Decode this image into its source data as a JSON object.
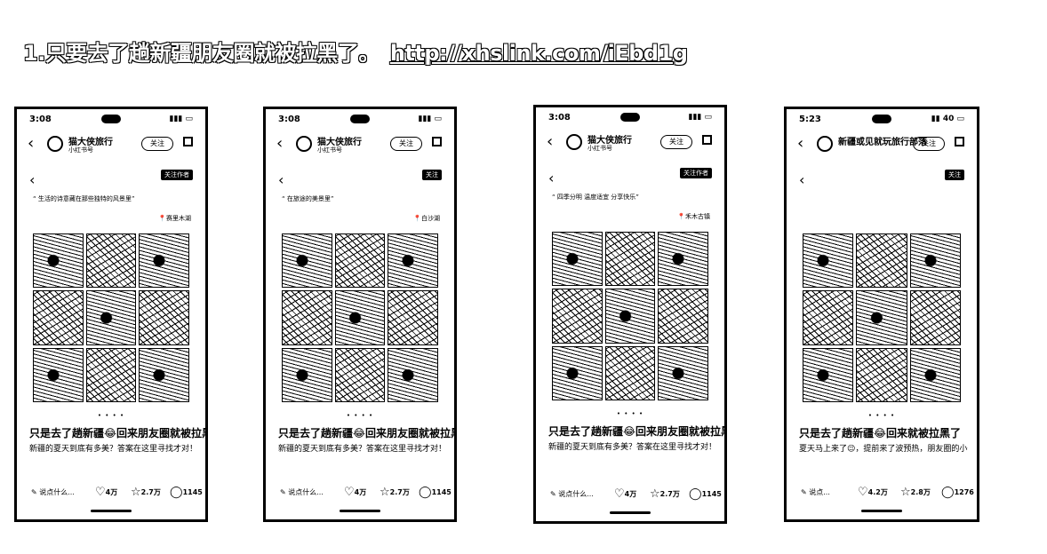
{
  "headline": {
    "text": "1.只要去了趟新疆朋友圈就被拉黑了。",
    "link": "http://xhslink.com/iEbd1g"
  },
  "phones": [
    {
      "time": "3:08",
      "author": "猫大侠旅行",
      "author_sub": "小红书号",
      "follow": "关注",
      "badge": "关注作者",
      "caption": "“ 生活的诗意藏在那些独特的风景里”",
      "location": "赛里木湖",
      "title": "只是去了趟新疆😂回来朋友圈就被拉黑了",
      "desc": "新疆的夏天到底有多美？答案在这里寻找才对！去新疆的每一天都忍不住为它的美景感叹，",
      "comment": "说点什么...",
      "likes": "4万",
      "stars": "2.7万",
      "comments": "1145"
    },
    {
      "time": "3:08",
      "author": "猫大侠旅行",
      "author_sub": "小红书号",
      "follow": "关注",
      "badge": "关注",
      "caption": "“ 在旅途的美景里”",
      "location": "白沙湖",
      "title": "只是去了趟新疆😂回来朋友圈就被拉黑了",
      "desc": "新疆的夏天到底有多美？答案在这里寻找才对！去新疆的每一天都忍不住为它的美景感叹，",
      "comment": "说点什么...",
      "likes": "4万",
      "stars": "2.7万",
      "comments": "1145"
    },
    {
      "time": "3:08",
      "author": "猫大侠旅行",
      "author_sub": "小红书号",
      "follow": "关注",
      "badge": "关注作者",
      "caption": "“ 四季分明 温度适宜 分享快乐”",
      "location": "禾木古镇",
      "title": "只是去了趟新疆😂回来朋友圈就被拉黑了",
      "desc": "新疆的夏天到底有多美？答案在这里寻找才对！去新疆的每一天都忍不住为它的美景感叹，",
      "comment": "说点什么...",
      "likes": "4万",
      "stars": "2.7万",
      "comments": "1145"
    },
    {
      "time": "5:23",
      "author": "新疆或见就玩旅行部落",
      "author_sub": "",
      "follow": "关注",
      "badge": "关注",
      "caption": "",
      "location": "",
      "title": "只是去了趟新疆😂回来就被拉黑了",
      "desc": "夏天马上来了😉，提前来了波预热，朋友圈的小伙伴们看我发美照都直接点赞😂，结果怕我扰",
      "comment": "说点...",
      "likes": "4.2万",
      "stars": "2.8万",
      "comments": "1276"
    }
  ]
}
